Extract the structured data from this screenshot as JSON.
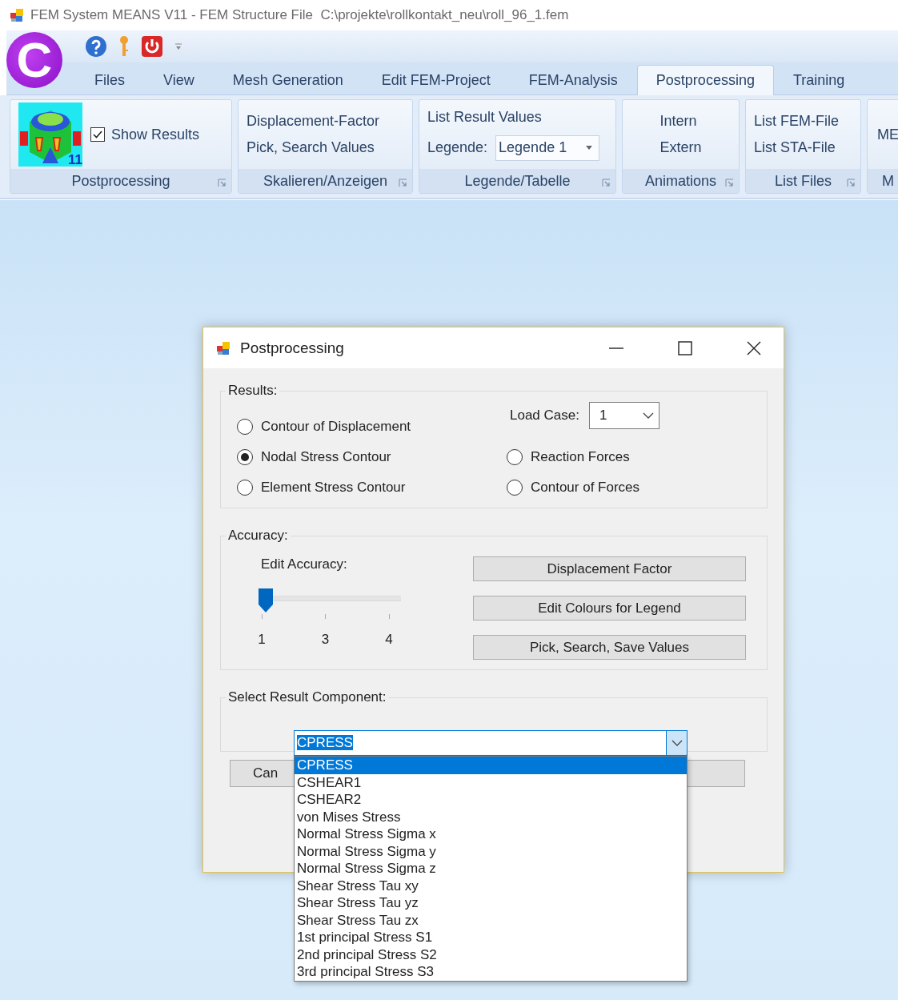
{
  "window": {
    "title": "FEM System MEANS V11 - FEM Structure File  C:\\projekte\\rollkontakt_neu\\roll_96_1.fem"
  },
  "logo": {
    "text": "C"
  },
  "tabs": [
    {
      "label": "Files",
      "selected": false
    },
    {
      "label": "View",
      "selected": false
    },
    {
      "label": "Mesh Generation",
      "selected": false
    },
    {
      "label": "Edit FEM-Project",
      "selected": false
    },
    {
      "label": "FEM-Analysis",
      "selected": false
    },
    {
      "label": "Postprocessing",
      "selected": true
    },
    {
      "label": "Training",
      "selected": false
    }
  ],
  "ribbon_groups": [
    {
      "title": "Postprocessing",
      "launcher": true,
      "items": [
        {
          "kind": "thumbnail",
          "badge": "11"
        },
        {
          "kind": "checkbox",
          "label": "Show Results",
          "checked": true
        }
      ]
    },
    {
      "title": "Skalieren/Anzeigen",
      "launcher": true,
      "items": [
        {
          "kind": "command",
          "label": "Displacement-Factor"
        },
        {
          "kind": "command",
          "label": "Pick, Search Values"
        }
      ]
    },
    {
      "title": "Legende/Tabelle",
      "launcher": true,
      "items": [
        {
          "kind": "command",
          "label": "List Result Values"
        },
        {
          "kind": "combo",
          "label": "Legende:",
          "value": "Legende 1"
        }
      ]
    },
    {
      "title": "Animations",
      "launcher": true,
      "items": [
        {
          "kind": "command",
          "label": "Intern"
        },
        {
          "kind": "command",
          "label": "Extern"
        }
      ]
    },
    {
      "title": "List Files",
      "launcher": true,
      "items": [
        {
          "kind": "command",
          "label": "List FEM-File"
        },
        {
          "kind": "command",
          "label": "List STA-File"
        }
      ]
    },
    {
      "title": "M",
      "items": [
        {
          "kind": "command",
          "label": "ME"
        }
      ]
    }
  ],
  "dialog": {
    "title": "Postprocessing",
    "results": {
      "label": "Results:",
      "load_case": {
        "label": "Load Case:",
        "value": "1"
      },
      "options": [
        {
          "label": "Contour of Displacement",
          "selected": false
        },
        {
          "label": "Nodal Stress Contour",
          "selected": true
        },
        {
          "label": "Element Stress Contour",
          "selected": false
        },
        {
          "label": "Reaction Forces",
          "selected": false
        },
        {
          "label": "Contour of Forces",
          "selected": false
        }
      ]
    },
    "accuracy": {
      "label": "Accuracy:",
      "slider_label": "Edit Accuracy:",
      "level": 0,
      "ticks": [
        "1",
        "3",
        "4"
      ],
      "buttons": [
        "Displacement Factor",
        "Edit Colours for Legend",
        "Pick, Search, Save Values"
      ]
    },
    "component": {
      "label": "Select Result Component:",
      "value": "CPRESS",
      "options": [
        {
          "label": "CPRESS",
          "selected": true
        },
        {
          "label": "CSHEAR1",
          "selected": false
        },
        {
          "label": "CSHEAR2",
          "selected": false
        },
        {
          "label": "von Mises Stress",
          "selected": false
        },
        {
          "label": "Normal Stress Sigma x",
          "selected": false
        },
        {
          "label": "Normal Stress Sigma y",
          "selected": false
        },
        {
          "label": "Normal Stress Sigma z",
          "selected": false
        },
        {
          "label": "Shear Stress Tau xy",
          "selected": false
        },
        {
          "label": "Shear Stress Tau yz",
          "selected": false
        },
        {
          "label": "Shear Stress Tau zx",
          "selected": false
        },
        {
          "label": "1st principal Stress S1",
          "selected": false
        },
        {
          "label": "2nd principal Stress S2",
          "selected": false
        },
        {
          "label": "3rd principal Stress S3",
          "selected": false
        }
      ]
    },
    "buttons": [
      "Can"
    ]
  }
}
